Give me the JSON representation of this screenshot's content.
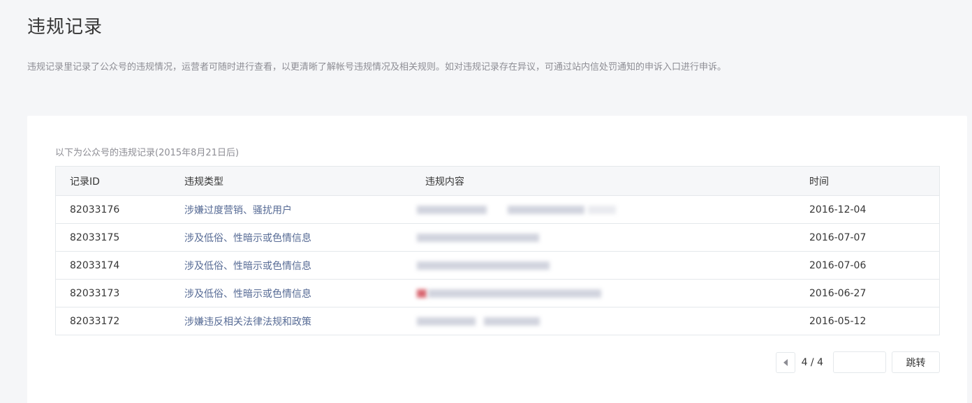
{
  "page": {
    "title": "违规记录",
    "description": "违规记录里记录了公众号的违规情况，运营者可随时进行查看，以更清晰了解帐号违规情况及相关规则。如对违规记录存在异议，可通过站内信处罚通知的申诉入口进行申诉。"
  },
  "card": {
    "caption": "以下为公众号的违规记录(2015年8月21日后)"
  },
  "table": {
    "headers": {
      "id": "记录ID",
      "type": "违规类型",
      "content": "违规内容",
      "time": "时间"
    },
    "rows": [
      {
        "id": "82033176",
        "type": "涉嫌过度营销、骚扰用户",
        "time": "2016-12-04",
        "content_obscured": true
      },
      {
        "id": "82033175",
        "type": "涉及低俗、性暗示或色情信息",
        "time": "2016-07-07",
        "content_obscured": true
      },
      {
        "id": "82033174",
        "type": "涉及低俗、性暗示或色情信息",
        "time": "2016-07-06",
        "content_obscured": true
      },
      {
        "id": "82033173",
        "type": "涉及低俗、性暗示或色情信息",
        "time": "2016-06-27",
        "content_obscured": true
      },
      {
        "id": "82033172",
        "type": "涉嫌违反相关法律法规和政策",
        "time": "2016-05-12",
        "content_obscured": true
      }
    ]
  },
  "pagination": {
    "page_label": "4 / 4",
    "jump_input_value": "",
    "jump_label": "跳转",
    "prev_icon": "triangle-left-icon"
  },
  "colors": {
    "background": "#f5f6f8",
    "card": "#ffffff",
    "link": "#576b95",
    "muted": "#8d8d94",
    "border": "#e4e8eb",
    "header_bg": "#f6f7f9"
  }
}
